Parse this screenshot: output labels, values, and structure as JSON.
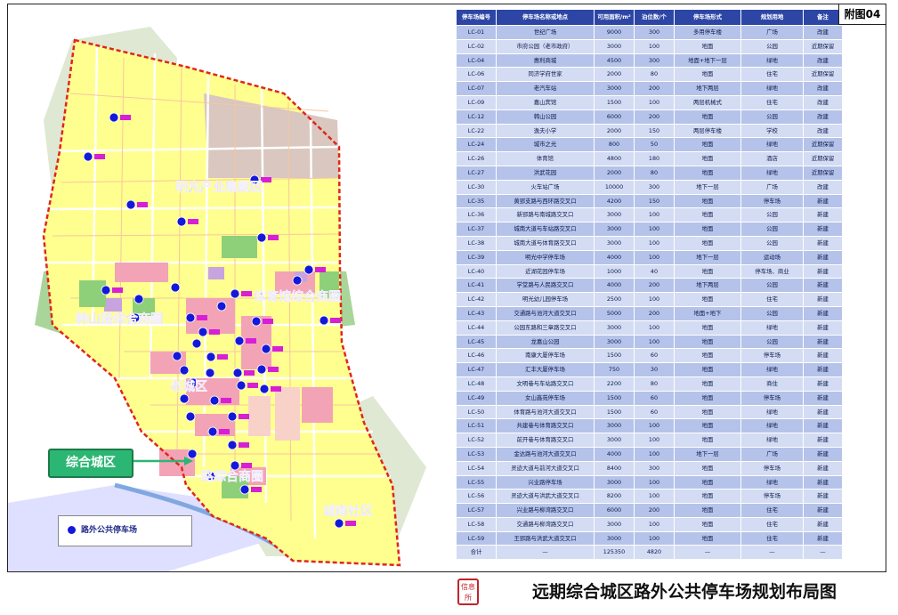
{
  "annex_label": "附图04",
  "title": "远期综合城区路外公共停车场规划布局图",
  "seal_text": "信息所",
  "zone_callout": "综合城区",
  "legend": {
    "label": "路外公共停车场"
  },
  "district_labels": [
    "明光产业集聚区",
    "体育馆综合商圈",
    "韩山路综合商圈",
    "老城区",
    "路综合商圈",
    "城南社区"
  ],
  "colors": {
    "parking_marker": "#1418d9",
    "boundary": "#e0261b",
    "header": "#2d46a6",
    "residential": "#ffff88",
    "commercial": "#f2a6b5",
    "green": "#8ed07a"
  },
  "table": {
    "headers": [
      "停车场编号",
      "停车场名称或地点",
      "可用面积/m²",
      "泊位数/个",
      "停车场形式",
      "规划用地",
      "备注"
    ],
    "rows": [
      [
        "LC-01",
        "世纪广场",
        "9000",
        "300",
        "多用停车楼",
        "广场",
        "改建"
      ],
      [
        "LC-02",
        "市府公园（老市政府）",
        "3000",
        "100",
        "地面",
        "公园",
        "近期保留"
      ],
      [
        "LC-04",
        "惠利商城",
        "4500",
        "300",
        "地面+地下一层",
        "绿地",
        "改建"
      ],
      [
        "LC-06",
        "同济学府世家",
        "2000",
        "80",
        "地面",
        "住宅",
        "近期保留"
      ],
      [
        "LC-07",
        "老汽车站",
        "3000",
        "200",
        "地下两层",
        "绿地",
        "改建"
      ],
      [
        "LC-09",
        "嘉山宾馆",
        "1500",
        "100",
        "两层机械式",
        "住宅",
        "改建"
      ],
      [
        "LC-12",
        "韩山公园",
        "6000",
        "200",
        "地面",
        "公园",
        "改建"
      ],
      [
        "LC-22",
        "逸夫小学",
        "2000",
        "150",
        "两层停车楼",
        "学校",
        "改建"
      ],
      [
        "LC-24",
        "城市之光",
        "800",
        "50",
        "地面",
        "绿地",
        "近期保留"
      ],
      [
        "LC-26",
        "体育馆",
        "4800",
        "180",
        "地面",
        "酒店",
        "近期保留"
      ],
      [
        "LC-27",
        "洪武花园",
        "2000",
        "80",
        "地面",
        "绿地",
        "近期保留"
      ],
      [
        "LC-30",
        "火车站广场",
        "10000",
        "300",
        "地下一层",
        "广场",
        "改建"
      ],
      [
        "LC-35",
        "黄郢支路与西环路交叉口",
        "4200",
        "150",
        "地面",
        "停车场",
        "新建"
      ],
      [
        "LC-36",
        "新郢路与南城路交叉口",
        "3000",
        "100",
        "地面",
        "公园",
        "新建"
      ],
      [
        "LC-37",
        "城南大道与车站路交叉口",
        "3000",
        "100",
        "地面",
        "公园",
        "新建"
      ],
      [
        "LC-38",
        "城南大道与体育路交叉口",
        "3000",
        "100",
        "地面",
        "公园",
        "新建"
      ],
      [
        "LC-39",
        "明光中学停车场",
        "4000",
        "100",
        "地下一层",
        "运动场",
        "新建"
      ],
      [
        "LC-40",
        "近湖花园停车场",
        "1000",
        "40",
        "地面",
        "停车场、商业",
        "新建"
      ],
      [
        "LC-41",
        "学堂路与人民路交叉口",
        "4000",
        "200",
        "地下两层",
        "公园",
        "新建"
      ],
      [
        "LC-42",
        "明光幼儿园停车场",
        "2500",
        "100",
        "地面",
        "住宅",
        "新建"
      ],
      [
        "LC-43",
        "交通路与池河大道交叉口",
        "5000",
        "200",
        "地面+地下",
        "公园",
        "新建"
      ],
      [
        "LC-44",
        "公园东路和三章路交叉口",
        "3000",
        "100",
        "地面",
        "绿地",
        "新建"
      ],
      [
        "LC-45",
        "龙嘉山公园",
        "3000",
        "100",
        "地面",
        "公园",
        "新建"
      ],
      [
        "LC-46",
        "南康大厦停车场",
        "1500",
        "60",
        "地面",
        "停车场",
        "新建"
      ],
      [
        "LC-47",
        "汇丰大厦停车场",
        "750",
        "30",
        "地面",
        "绿地",
        "新建"
      ],
      [
        "LC-48",
        "文明巷与车站路交叉口",
        "2200",
        "80",
        "地面",
        "商住",
        "新建"
      ],
      [
        "LC-49",
        "女山鑫苑停车场",
        "1500",
        "60",
        "地面",
        "停车场",
        "新建"
      ],
      [
        "LC-50",
        "体育路与池河大道交叉口",
        "1500",
        "60",
        "地面",
        "绿地",
        "新建"
      ],
      [
        "LC-51",
        "共建巷与体育路交叉口",
        "3000",
        "100",
        "地面",
        "绿地",
        "新建"
      ],
      [
        "LC-52",
        "前开巷与体育路交叉口",
        "3000",
        "100",
        "地面",
        "绿地",
        "新建"
      ],
      [
        "LC-53",
        "金达路与池河大道交叉口",
        "4000",
        "100",
        "地下一层",
        "广场",
        "新建"
      ],
      [
        "LC-54",
        "灵迹大道与前河大道交叉口",
        "8400",
        "300",
        "地面",
        "停车场",
        "新建"
      ],
      [
        "LC-55",
        "兴业路停车场",
        "3000",
        "100",
        "地面",
        "绿地",
        "新建"
      ],
      [
        "LC-56",
        "灵迹大道与洪武大道交叉口",
        "8200",
        "100",
        "地面",
        "停车场",
        "新建"
      ],
      [
        "LC-57",
        "兴业路与柳湾路交叉口",
        "6000",
        "200",
        "地面",
        "住宅",
        "新建"
      ],
      [
        "LC-58",
        "交通路与柳湾路交叉口",
        "3000",
        "100",
        "地面",
        "住宅",
        "新建"
      ],
      [
        "LC-59",
        "王郢路与洪武大道交叉口",
        "3000",
        "100",
        "地面",
        "住宅",
        "新建"
      ],
      [
        "合计",
        "—",
        "125350",
        "4820",
        "—",
        "—",
        "—"
      ]
    ]
  }
}
